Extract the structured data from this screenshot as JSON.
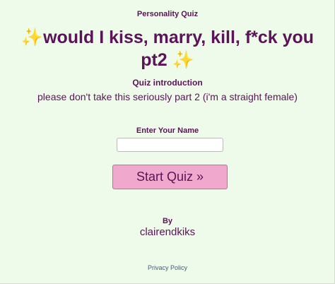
{
  "header": {
    "category": "Personality Quiz"
  },
  "quiz": {
    "sparkle_left": "✨",
    "title": "would I kiss, marry, kill, f*ck you pt2",
    "sparkle_right": "✨",
    "intro_heading": "Quiz introduction",
    "intro_text": "please don't take this seriously part 2 (i'm a straight female)"
  },
  "form": {
    "name_label": "Enter Your Name",
    "name_value": "",
    "start_label": "Start Quiz »"
  },
  "author": {
    "by_label": "By",
    "name": "clairendkiks"
  },
  "footer": {
    "privacy_label": "Privacy Policy"
  },
  "colors": {
    "background": "#eefaea",
    "text": "#5a1457",
    "button": "#f0a8cc",
    "link": "#3f5f86",
    "sparkle": "#f2c233"
  },
  "icons": {
    "sparkles": "sparkles-icon"
  }
}
